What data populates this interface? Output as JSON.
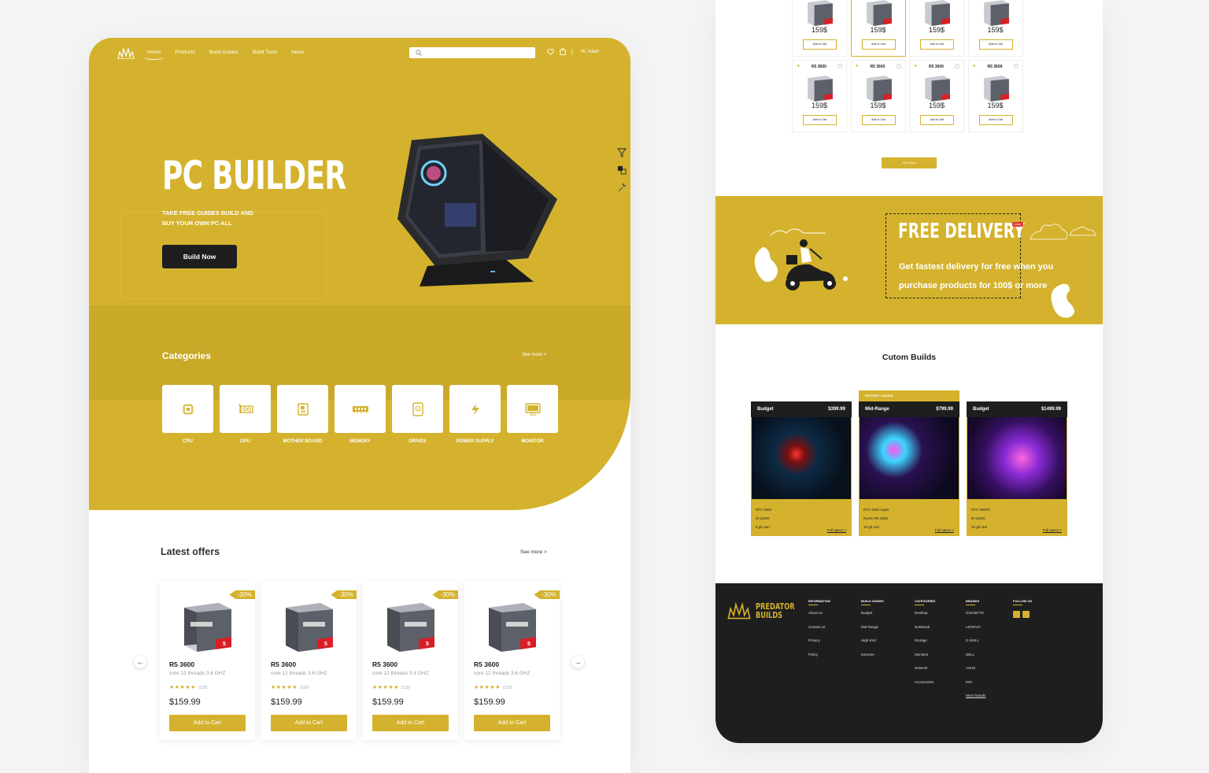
{
  "nav": {
    "links": [
      "Home",
      "Products",
      "Build Guides",
      "Build Tools",
      "News"
    ],
    "greeting": "Hi, Islam"
  },
  "hero": {
    "title": "PC BUILDER",
    "subtitle": "TAKE FREE GUIDES  BUILD AND BUY YOUR OWN PC ALL",
    "button": "Build Now"
  },
  "categories": {
    "title": "Categories",
    "see_more": "See more >",
    "items": [
      "CPU",
      "GPU",
      "MOTHER BOARD",
      "MEMORY",
      "DRIVES",
      "POWER SUPPLY",
      "MONITOR"
    ]
  },
  "latest": {
    "title": "Latest offers",
    "see_more": "See more >",
    "items": [
      {
        "discount": "-30%",
        "name": "R5 3600",
        "desc": "core 12 threads 3.6 GHZ",
        "stars": "★★★★★",
        "reviews": "(119)",
        "price": "$159.99",
        "cta": "Add to Cart"
      },
      {
        "discount": "-30%",
        "name": "R5 3600",
        "desc": "core 12 threads 3.6 GHZ",
        "stars": "★★★★★",
        "reviews": "(119)",
        "price": "$159.99",
        "cta": "Add to Cart"
      },
      {
        "discount": "-30%",
        "name": "R5 3600",
        "desc": "core 12 threads 3.6 GHZ",
        "stars": "★★★★★",
        "reviews": "(119)",
        "price": "$159.99",
        "cta": "Add to Cart"
      },
      {
        "discount": "-30%",
        "name": "R5 3600",
        "desc": "core 12 threads 3.6 GHZ",
        "stars": "★★★★★",
        "reviews": "(119)",
        "price": "$159.99",
        "cta": "Add to Cart"
      }
    ]
  },
  "grid": {
    "top_row": [
      {
        "price": "159$",
        "cta": "Add to Cart"
      },
      {
        "price": "159$",
        "cta": "Add to Cart"
      },
      {
        "price": "159$",
        "cta": "Add to Cart"
      },
      {
        "price": "159$",
        "cta": "Add to Cart"
      }
    ],
    "bottom_row": [
      {
        "name": "R5 3600",
        "price": "159$",
        "cta": "Add to Cart"
      },
      {
        "name": "R5 3600",
        "price": "159$",
        "cta": "Add to Cart"
      },
      {
        "name": "R5 3600",
        "price": "159$",
        "cta": "Add to Cart"
      },
      {
        "name": "R5 3600",
        "price": "159$",
        "cta": "Add to Cart"
      }
    ],
    "see_more": "See More"
  },
  "delivery": {
    "title": "FREE DELIVERY",
    "tag": "FREE",
    "line1_a": "Get fastest delivery for ",
    "line1_b": "free",
    "line1_c": " when you",
    "line2_a": "purchase products for ",
    "line2_b": "100$",
    "line2_c": " or more"
  },
  "custom": {
    "title": "Cutom Builds",
    "editors_choice": "EDITORS' CHOICE",
    "builds": [
      {
        "tier": "Budget",
        "price": "$399.99",
        "gpu": "RTX 3050",
        "cpu": "i3-12400",
        "ram": "8 gb ram",
        "more": "Full specs >"
      },
      {
        "tier": "Mid-Range",
        "price": "$799.99",
        "gpu": "RTX 2060 super",
        "cpu": "Ryzen R5 3600",
        "ram": "16 gb ram",
        "more": "Full specs >"
      },
      {
        "tier": "Budget",
        "price": "$1499.99",
        "gpu": "RTX 3080TI",
        "cpu": "i9-12400",
        "ram": "32 gb ram",
        "more": "Full specs >"
      }
    ]
  },
  "footer": {
    "brand_line1": "PREDATOR",
    "brand_line2": "BUILDS",
    "cols": [
      {
        "title": "INFORMATION",
        "items": [
          "About us",
          "Contact us",
          "Privacy",
          "Policy"
        ]
      },
      {
        "title": "BUILD GUIDES",
        "items": [
          "Budget",
          "Mid-Range",
          "High-End",
          "Extreme"
        ]
      },
      {
        "title": "CATEGORIES",
        "items": [
          "Desktop",
          "Notebook",
          "Storage",
          "Monitors",
          "Network",
          "Accessories"
        ]
      },
      {
        "title": "BRANDS",
        "items": [
          "GIGABYTE",
          "LENOVO",
          "G.SKILL",
          "DELL",
          "ASUS",
          "MSI",
          "More brands"
        ]
      },
      {
        "title": "FOLLOW US",
        "items": []
      }
    ]
  },
  "colors": {
    "accent": "#d4b22d",
    "dark": "#1e1e1e"
  }
}
